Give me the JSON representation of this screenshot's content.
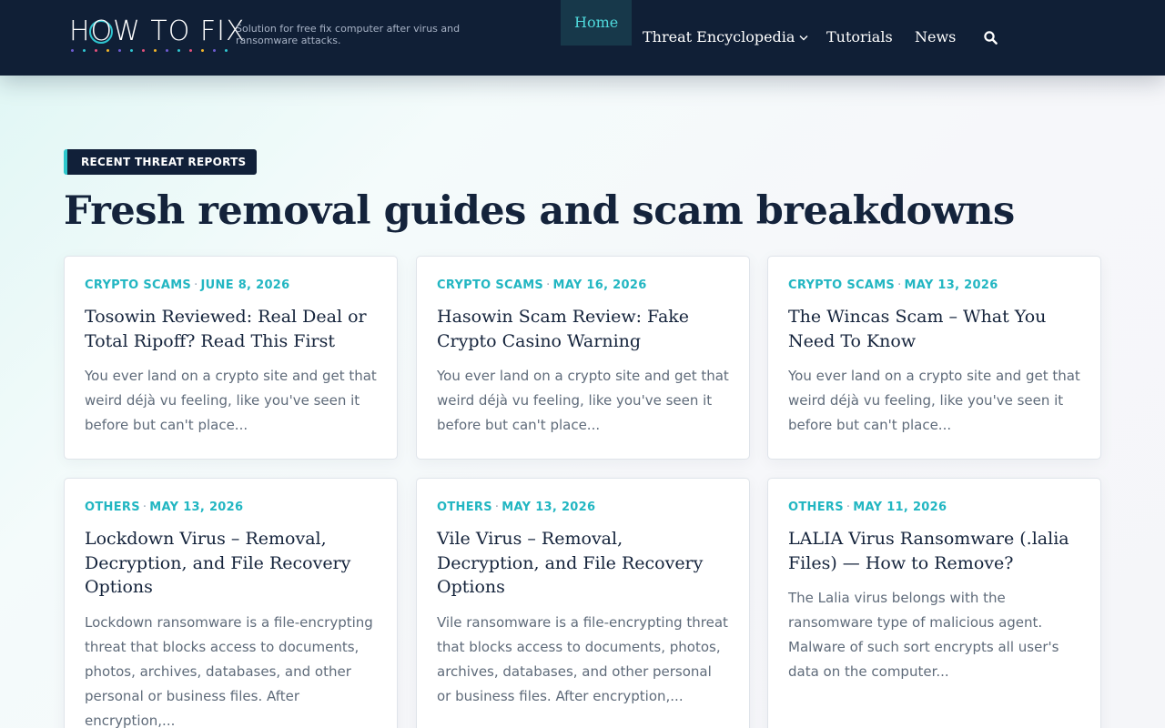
{
  "site": {
    "logo_text": "HOW TO FIX",
    "tagline": "Solution for free fix computer after virus and ransomware attacks."
  },
  "nav": {
    "items": [
      {
        "label": "Home",
        "active": true
      },
      {
        "label": "Threat Encyclopedia",
        "has_dropdown": true
      },
      {
        "label": "Tutorials"
      },
      {
        "label": "News"
      }
    ],
    "search_icon": "search-icon"
  },
  "section": {
    "badge": "RECENT THREAT REPORTS",
    "headline": "Fresh removal guides and scam breakdowns"
  },
  "cards": [
    {
      "category": "CRYPTO SCAMS",
      "date": "JUNE 8, 2026",
      "title": "Tosowin Reviewed: Real Deal or Total Ripoff? Read This First",
      "excerpt": "You ever land on a crypto site and get that weird déjà vu feeling, like you've seen it before but can't place..."
    },
    {
      "category": "CRYPTO SCAMS",
      "date": "MAY 16, 2026",
      "title": "Hasowin Scam Review: Fake Crypto Casino Warning",
      "excerpt": "You ever land on a crypto site and get that weird déjà vu feeling, like you've seen it before but can't place..."
    },
    {
      "category": "CRYPTO SCAMS",
      "date": "MAY 13, 2026",
      "title": "The Wincas Scam – What You Need To Know",
      "excerpt": "You ever land on a crypto site and get that weird déjà vu feeling, like you've seen it before but can't place..."
    },
    {
      "category": "OTHERS",
      "date": "MAY 13, 2026",
      "title": "Lockdown Virus – Removal, Decryption, and File Recovery Options",
      "excerpt": "Lockdown ransomware is a file-encrypting threat that blocks access to documents, photos, archives, databases, and other personal or business files. After encryption,..."
    },
    {
      "category": "OTHERS",
      "date": "MAY 13, 2026",
      "title": "Vile Virus – Removal, Decryption, and File Recovery Options",
      "excerpt": "Vile ransomware is a file-encrypting threat that blocks access to documents, photos, archives, databases, and other personal or business files. After encryption,..."
    },
    {
      "category": "OTHERS",
      "date": "MAY 11, 2026",
      "title": "LALIA Virus Ransomware (.lalia Files) — How to Remove?",
      "excerpt": "The Lalia virus belongs with the ransomware type of malicious agent. Malware of such sort encrypts all user's data on the computer..."
    }
  ],
  "colors": {
    "header_bg": "#101f36",
    "accent": "#22b6c2",
    "nav_active_text": "#4fd9dc",
    "heading": "#14233b"
  }
}
